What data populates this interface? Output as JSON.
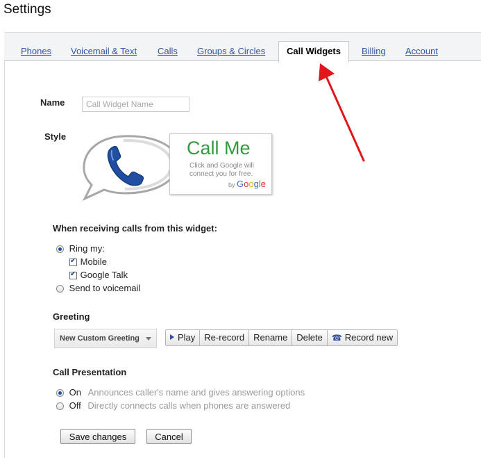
{
  "page": {
    "title": "Settings"
  },
  "tabs": [
    {
      "label": "Phones"
    },
    {
      "label": "Voicemail & Text"
    },
    {
      "label": "Calls"
    },
    {
      "label": "Groups & Circles"
    },
    {
      "label": "Call Widgets",
      "active": true
    },
    {
      "label": "Billing"
    },
    {
      "label": "Account"
    }
  ],
  "form": {
    "name_label": "Name",
    "name_placeholder": "Call Widget Name",
    "name_value": "",
    "style_label": "Style"
  },
  "widget": {
    "title": "Call Me",
    "subtitle": "Click and Google will connect you for free.",
    "by": "by",
    "brand": "Google",
    "brand_letters": [
      "G",
      "o",
      "o",
      "g",
      "l",
      "e"
    ],
    "brand_colors": [
      "#3b6fd6",
      "#d9352b",
      "#f2b40e",
      "#3b6fd6",
      "#2e9c3d",
      "#d9352b"
    ],
    "title_color": "#2e9c3d",
    "phone_color": "#1f4ea3"
  },
  "receiving": {
    "heading": "When receiving calls from this widget:",
    "ring_label": "Ring my:",
    "ring_selected": true,
    "mobile_label": "Mobile",
    "mobile_checked": true,
    "gtalk_label": "Google Talk",
    "gtalk_checked": true,
    "voicemail_label": "Send to voicemail",
    "voicemail_selected": false
  },
  "greeting": {
    "heading": "Greeting",
    "selected": "New Custom Greeting",
    "buttons": {
      "play": "Play",
      "rerecord": "Re-record",
      "rename": "Rename",
      "delete": "Delete",
      "record_new": "Record new"
    }
  },
  "presentation": {
    "heading": "Call Presentation",
    "on_label": "On",
    "on_desc": "Announces caller's name and gives answering options",
    "on_selected": true,
    "off_label": "Off",
    "off_desc": "Directly connects calls when phones are answered",
    "off_selected": false
  },
  "actions": {
    "save": "Save changes",
    "cancel": "Cancel"
  },
  "colors": {
    "arrow": "#e0161b",
    "link": "#2b57a6",
    "accent_blue": "#1f4ea3",
    "green": "#2e9c3d"
  }
}
